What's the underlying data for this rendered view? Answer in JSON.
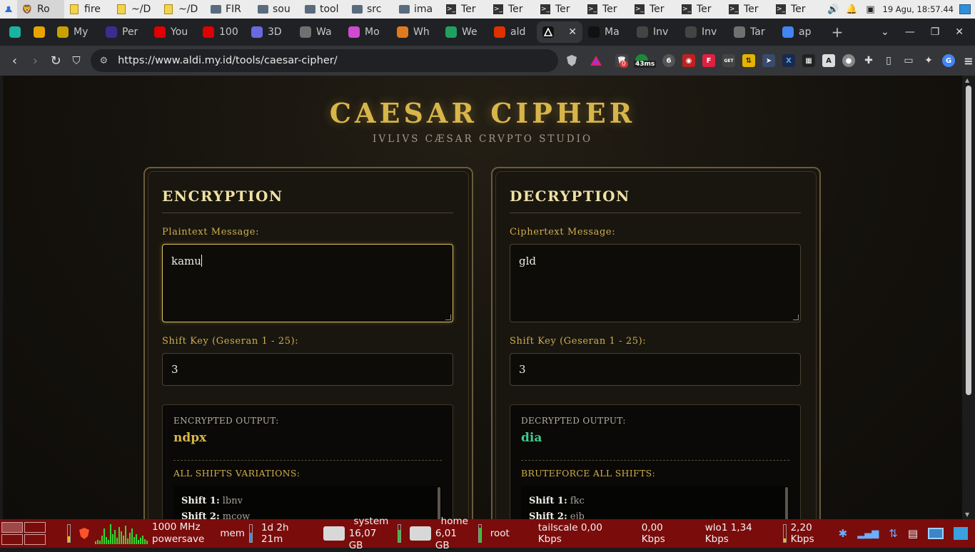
{
  "system_top": {
    "tasks": [
      {
        "label": "Ro",
        "icon": "brave-icon",
        "active": true
      },
      {
        "label": "fire",
        "icon": "text-editor-icon"
      },
      {
        "label": "~/D",
        "icon": "text-editor-icon"
      },
      {
        "label": "~/D",
        "icon": "text-editor-icon"
      },
      {
        "label": "FIR",
        "icon": "folder-icon"
      },
      {
        "label": "sou",
        "icon": "folder-icon"
      },
      {
        "label": "tool",
        "icon": "folder-icon"
      },
      {
        "label": "src",
        "icon": "folder-icon"
      },
      {
        "label": "ima",
        "icon": "folder-icon"
      },
      {
        "label": "Ter",
        "icon": "terminal-icon"
      },
      {
        "label": "Ter",
        "icon": "terminal-icon"
      },
      {
        "label": "Ter",
        "icon": "terminal-icon"
      },
      {
        "label": "Ter",
        "icon": "terminal-icon"
      },
      {
        "label": "Ter",
        "icon": "terminal-icon"
      },
      {
        "label": "Ter",
        "icon": "terminal-icon"
      },
      {
        "label": "Ter",
        "icon": "terminal-icon"
      },
      {
        "label": "Ter",
        "icon": "terminal-icon"
      }
    ],
    "clock": "19 Agu, 18:57.44"
  },
  "tabs": [
    {
      "label": "",
      "pinned": true,
      "color": "#19b3a0"
    },
    {
      "label": "",
      "pinned": true,
      "color": "#e8a400"
    },
    {
      "label": "My",
      "color": "#c8a000"
    },
    {
      "label": "Per",
      "color": "#3a2d8f"
    },
    {
      "label": "You",
      "color": "#e00000"
    },
    {
      "label": "100",
      "color": "#e00000"
    },
    {
      "label": "3D",
      "color": "#6a6ae0"
    },
    {
      "label": "Wa",
      "color": "#707070"
    },
    {
      "label": "Mo",
      "color": "#d04ad0"
    },
    {
      "label": "Wh",
      "color": "#e07a20"
    },
    {
      "label": "We",
      "color": "#20a060"
    },
    {
      "label": "ald",
      "color": "#e03000"
    },
    {
      "label": "",
      "active": true,
      "color": "#111111"
    },
    {
      "label": "Ma",
      "color": "#111111"
    },
    {
      "label": "Inv",
      "color": "#444444"
    },
    {
      "label": "Inv",
      "color": "#444444"
    },
    {
      "label": "Tar",
      "color": "#707070"
    },
    {
      "label": "ap",
      "color": "#4285f4"
    }
  ],
  "toolbar": {
    "url": "https://www.aldi.my.id/tools/caesar-cipher/",
    "ext_badge_count": "0",
    "ext_badge_ms": "43ms"
  },
  "page": {
    "title": "CAESAR CIPHER",
    "subtitle": "IVLIVS CÆSAR CRVPTO STUDIO",
    "encryption": {
      "heading": "ENCRYPTION",
      "input_label": "Plaintext Message:",
      "input_value": "kamu",
      "shift_label": "Shift Key (Geseran 1 - 25):",
      "shift_value": "3",
      "output_label": "ENCRYPTED OUTPUT:",
      "output_value": "ndpx",
      "output_color": "#d8b54a",
      "variations_label": "ALL SHIFTS VARIATIONS:",
      "variations": [
        {
          "key": "Shift 1:",
          "value": "lbnv"
        },
        {
          "key": "Shift 2:",
          "value": "mcow"
        }
      ]
    },
    "decryption": {
      "heading": "DECRYPTION",
      "input_label": "Ciphertext Message:",
      "input_value": "gld",
      "shift_label": "Shift Key (Geseran 1 - 25):",
      "shift_value": "3",
      "output_label": "DECRYPTED OUTPUT:",
      "output_value": "dia",
      "output_color": "#3ec98c",
      "variations_label": "BRUTEFORCE ALL SHIFTS:",
      "variations": [
        {
          "key": "Shift 1:",
          "value": "fkc"
        },
        {
          "key": "Shift 2:",
          "value": "ejb"
        }
      ]
    }
  },
  "system_bottom": {
    "cpu_freq": "1000 MHz",
    "cpu_governor": "powersave",
    "mem_label": "mem",
    "uptime": "1d 2h 21m",
    "disk_system_label": "system",
    "disk_system_free": "16,07 GB",
    "disk_home_label": "home",
    "disk_home_free": "6,01 GB",
    "user": "root",
    "net_tailscale": "tailscale 0,00 Kbps",
    "net_tailscale_up": "0,00 Kbps",
    "net_wlo1": "wlo1 1,34 Kbps",
    "net_wlo1_up": "2,20 Kbps",
    "cpu_level": 0.35,
    "mem_level": 0.55,
    "disk_system_level": 0.7,
    "disk_home_level": 0.85,
    "net_wlo1_level": 0.2
  }
}
